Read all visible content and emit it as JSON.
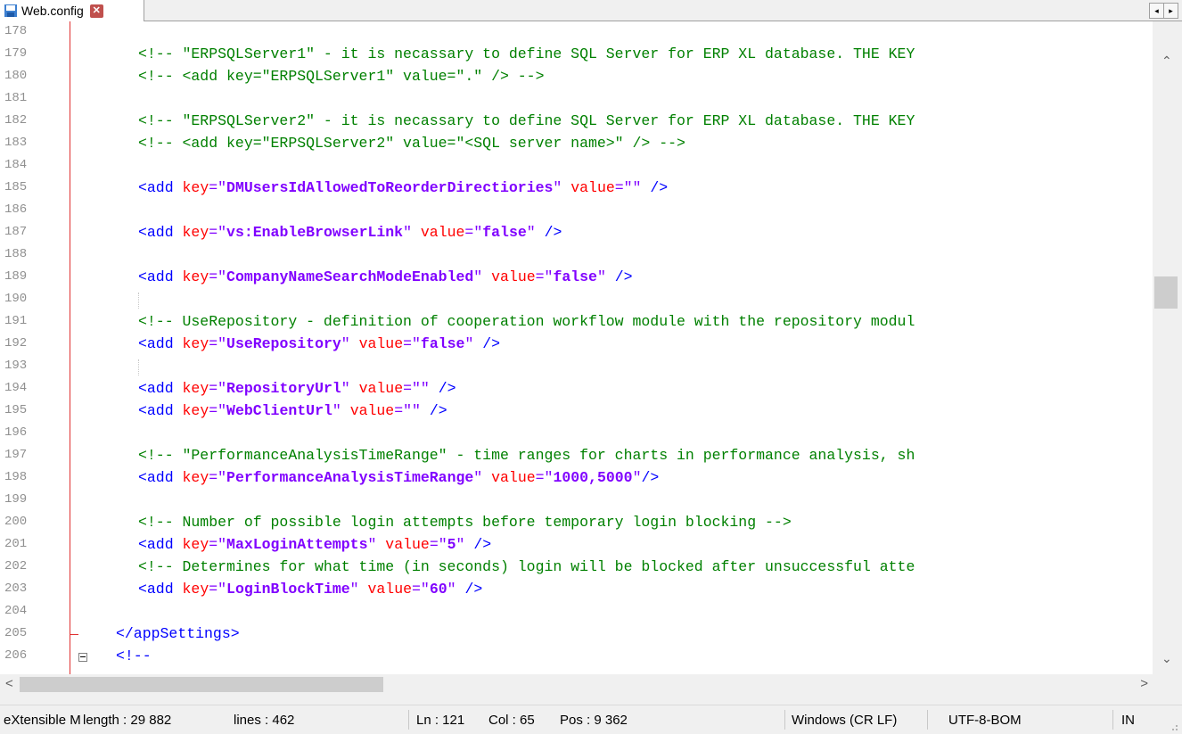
{
  "tab": {
    "name": "Web.config",
    "close_glyph": "✕"
  },
  "tabnav": {
    "left": "◂",
    "right": "▸"
  },
  "lines": [
    {
      "n": "178",
      "segs": []
    },
    {
      "n": "179",
      "segs": [
        {
          "c": "cm",
          "t": "<!-- \"ERPSQLServer1\" - it is necassary to define SQL Server for ERP XL database. THE KEY"
        }
      ]
    },
    {
      "n": "180",
      "segs": [
        {
          "c": "cm",
          "t": "<!-- <add key=\"ERPSQLServer1\" value=\".\" /> -->"
        }
      ]
    },
    {
      "n": "181",
      "segs": []
    },
    {
      "n": "182",
      "segs": [
        {
          "c": "cm",
          "t": "<!-- \"ERPSQLServer2\" - it is necassary to define SQL Server for ERP XL database. THE KEY"
        }
      ]
    },
    {
      "n": "183",
      "segs": [
        {
          "c": "cm",
          "t": "<!-- <add key=\"ERPSQLServer2\" value=\"<SQL server name>\" /> -->"
        }
      ]
    },
    {
      "n": "184",
      "segs": []
    },
    {
      "n": "185",
      "segs": [
        {
          "c": "tag",
          "t": "<add "
        },
        {
          "c": "attr",
          "t": "key"
        },
        {
          "c": "plain",
          "t": "=\""
        },
        {
          "c": "val",
          "t": "DMUsersIdAllowedToReorderDirectiories"
        },
        {
          "c": "plain",
          "t": "\" "
        },
        {
          "c": "attr",
          "t": "value"
        },
        {
          "c": "plain",
          "t": "=\"\" "
        },
        {
          "c": "tag",
          "t": "/>"
        }
      ]
    },
    {
      "n": "186",
      "segs": []
    },
    {
      "n": "187",
      "segs": [
        {
          "c": "tag",
          "t": "<add "
        },
        {
          "c": "attr",
          "t": "key"
        },
        {
          "c": "plain",
          "t": "=\""
        },
        {
          "c": "val",
          "t": "vs:EnableBrowserLink"
        },
        {
          "c": "plain",
          "t": "\" "
        },
        {
          "c": "attr",
          "t": "value"
        },
        {
          "c": "plain",
          "t": "=\""
        },
        {
          "c": "val",
          "t": "false"
        },
        {
          "c": "plain",
          "t": "\" "
        },
        {
          "c": "tag",
          "t": "/>"
        }
      ]
    },
    {
      "n": "188",
      "segs": []
    },
    {
      "n": "189",
      "segs": [
        {
          "c": "tag",
          "t": "<add "
        },
        {
          "c": "attr",
          "t": "key"
        },
        {
          "c": "plain",
          "t": "=\""
        },
        {
          "c": "val",
          "t": "CompanyNameSearchModeEnabled"
        },
        {
          "c": "plain",
          "t": "\" "
        },
        {
          "c": "attr",
          "t": "value"
        },
        {
          "c": "plain",
          "t": "=\""
        },
        {
          "c": "val",
          "t": "false"
        },
        {
          "c": "plain",
          "t": "\" "
        },
        {
          "c": "tag",
          "t": "/>"
        }
      ]
    },
    {
      "n": "190",
      "segs": []
    },
    {
      "n": "191",
      "segs": [
        {
          "c": "cm",
          "t": "<!-- UseRepository - definition of cooperation workflow module with the repository modul"
        }
      ]
    },
    {
      "n": "192",
      "segs": [
        {
          "c": "tag",
          "t": "<add "
        },
        {
          "c": "attr",
          "t": "key"
        },
        {
          "c": "plain",
          "t": "=\""
        },
        {
          "c": "val",
          "t": "UseRepository"
        },
        {
          "c": "plain",
          "t": "\" "
        },
        {
          "c": "attr",
          "t": "value"
        },
        {
          "c": "plain",
          "t": "=\""
        },
        {
          "c": "val",
          "t": "false"
        },
        {
          "c": "plain",
          "t": "\" "
        },
        {
          "c": "tag",
          "t": "/>"
        }
      ]
    },
    {
      "n": "193",
      "segs": []
    },
    {
      "n": "194",
      "segs": [
        {
          "c": "tag",
          "t": "<add "
        },
        {
          "c": "attr",
          "t": "key"
        },
        {
          "c": "plain",
          "t": "=\""
        },
        {
          "c": "val",
          "t": "RepositoryUrl"
        },
        {
          "c": "plain",
          "t": "\" "
        },
        {
          "c": "attr",
          "t": "value"
        },
        {
          "c": "plain",
          "t": "=\"\" "
        },
        {
          "c": "tag",
          "t": "/>"
        }
      ]
    },
    {
      "n": "195",
      "segs": [
        {
          "c": "tag",
          "t": "<add "
        },
        {
          "c": "attr",
          "t": "key"
        },
        {
          "c": "plain",
          "t": "=\""
        },
        {
          "c": "val",
          "t": "WebClientUrl"
        },
        {
          "c": "plain",
          "t": "\" "
        },
        {
          "c": "attr",
          "t": "value"
        },
        {
          "c": "plain",
          "t": "=\"\" "
        },
        {
          "c": "tag",
          "t": "/>"
        }
      ]
    },
    {
      "n": "196",
      "segs": []
    },
    {
      "n": "197",
      "segs": [
        {
          "c": "cm",
          "t": "<!-- \"PerformanceAnalysisTimeRange\" - time ranges for charts in performance analysis, sh"
        }
      ]
    },
    {
      "n": "198",
      "segs": [
        {
          "c": "tag",
          "t": "<add "
        },
        {
          "c": "attr",
          "t": "key"
        },
        {
          "c": "plain",
          "t": "=\""
        },
        {
          "c": "val",
          "t": "PerformanceAnalysisTimeRange"
        },
        {
          "c": "plain",
          "t": "\" "
        },
        {
          "c": "attr",
          "t": "value"
        },
        {
          "c": "plain",
          "t": "=\""
        },
        {
          "c": "val",
          "t": "1000,5000"
        },
        {
          "c": "plain",
          "t": "\""
        },
        {
          "c": "tag",
          "t": "/>"
        }
      ]
    },
    {
      "n": "199",
      "segs": []
    },
    {
      "n": "200",
      "segs": [
        {
          "c": "cm",
          "t": "<!-- Number of possible login attempts before temporary login blocking -->"
        }
      ]
    },
    {
      "n": "201",
      "segs": [
        {
          "c": "tag",
          "t": "<add "
        },
        {
          "c": "attr",
          "t": "key"
        },
        {
          "c": "plain",
          "t": "=\""
        },
        {
          "c": "val",
          "t": "MaxLoginAttempts"
        },
        {
          "c": "plain",
          "t": "\" "
        },
        {
          "c": "attr",
          "t": "value"
        },
        {
          "c": "plain",
          "t": "=\""
        },
        {
          "c": "val",
          "t": "5"
        },
        {
          "c": "plain",
          "t": "\" "
        },
        {
          "c": "tag",
          "t": "/>"
        }
      ]
    },
    {
      "n": "202",
      "segs": [
        {
          "c": "cm",
          "t": "<!-- Determines for what time (in seconds) login will be blocked after unsuccessful atte"
        }
      ]
    },
    {
      "n": "203",
      "segs": [
        {
          "c": "tag",
          "t": "<add "
        },
        {
          "c": "attr",
          "t": "key"
        },
        {
          "c": "plain",
          "t": "=\""
        },
        {
          "c": "val",
          "t": "LoginBlockTime"
        },
        {
          "c": "plain",
          "t": "\" "
        },
        {
          "c": "attr",
          "t": "value"
        },
        {
          "c": "plain",
          "t": "=\""
        },
        {
          "c": "val",
          "t": "60"
        },
        {
          "c": "plain",
          "t": "\" "
        },
        {
          "c": "tag",
          "t": "/>"
        }
      ]
    },
    {
      "n": "204",
      "segs": []
    },
    {
      "n": "205",
      "segs": [
        {
          "c": "tag",
          "t": "</appSettings>"
        }
      ]
    },
    {
      "n": "206",
      "segs": [
        {
          "c": "tag",
          "t": "<!--"
        }
      ]
    }
  ],
  "status": {
    "filetype": "eXtensible M",
    "length": "length : 29 882",
    "lines": "lines : 462",
    "ln": "Ln : 121",
    "col": "Col : 65",
    "pos": "Pos : 9 362",
    "eol": "Windows (CR LF)",
    "encoding": "UTF-8-BOM",
    "mode": "IN"
  },
  "colors": {
    "comment": "#008000",
    "tag": "#0000ff",
    "attribute": "#ff0000",
    "value": "#8000ff",
    "fold_line": "#e03030"
  },
  "icons": [
    "save-disk-icon",
    "close-tab-icon",
    "scroll-left-icon",
    "scroll-right-icon",
    "scroll-up-icon",
    "scroll-down-icon",
    "fold-minus-icon",
    "resize-grip-icon"
  ]
}
